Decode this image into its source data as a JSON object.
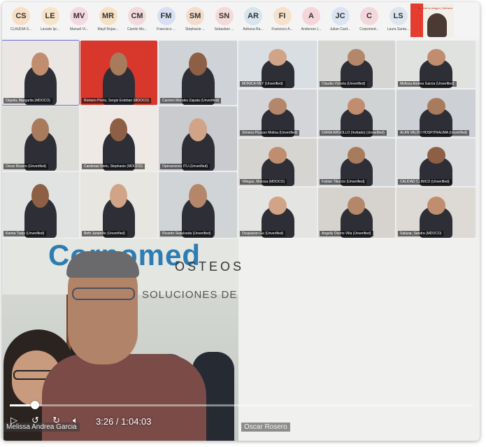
{
  "participants": [
    {
      "initials": "CS",
      "name": "CLAUDIA S...",
      "color": "#f6dfc4"
    },
    {
      "initials": "LE",
      "name": "Lavado Ije...",
      "color": "#f5e4c8"
    },
    {
      "initials": "MV",
      "name": "Manuel Vi...",
      "color": "#f4d8e3"
    },
    {
      "initials": "MR",
      "name": "Mayil Rojas...",
      "color": "#f5e2c4"
    },
    {
      "initials": "CM",
      "name": "Camilo Mu...",
      "color": "#f1d9dc"
    },
    {
      "initials": "FM",
      "name": "Francisco ...",
      "color": "#d8dff3"
    },
    {
      "initials": "SM",
      "name": "Stephanie ...",
      "color": "#f3dccb"
    },
    {
      "initials": "SN",
      "name": "Sebastian ...",
      "color": "#f5d9d9"
    },
    {
      "initials": "AR",
      "name": "Adriana Ra...",
      "color": "#d6e5ee"
    },
    {
      "initials": "FI",
      "name": "Francisco A...",
      "color": "#f5e1cc"
    },
    {
      "initials": "A",
      "name": "Anderson (...",
      "color": "#f4d6da"
    },
    {
      "initials": "JC",
      "name": "Julian Card...",
      "color": "#dbe4f3"
    },
    {
      "initials": "C",
      "name": "Corpomed...",
      "color": "#f4d7dc"
    },
    {
      "initials": "LS",
      "name": "Laura Santa...",
      "color": "#dde6ee"
    }
  ],
  "self_view": {
    "brand": "acelere la cirugía | Johnson"
  },
  "tiles": [
    {
      "label": "Orjuela, Margarita (MDOCO)"
    },
    {
      "label": "Romero Prieto, Sergio Esteban (MDOCO)"
    },
    {
      "label": "Carmen Morales Zapata (Unverified)"
    },
    {
      "label": "MONICA REY (Unverified)"
    },
    {
      "label": "Claudia Victoria (Unverified)"
    },
    {
      "label": "Melissa Andrea Garcia (Unverified)"
    },
    {
      "label": "Oscar Rosero (Unverified)"
    },
    {
      "label": "Cardenas Nieto, Stephanie (MDOCO)"
    },
    {
      "label": "Operaciones ITU (Unverified)"
    },
    {
      "label": "Ximena Picasso Molina (Unverified)"
    },
    {
      "label": "DIANA ARGOLLO (Invitado) (Unverified)"
    },
    {
      "label": "ALAN VALDO HOSPITRAUMA (Unverified)"
    },
    {
      "label": "Karina Tunjo (Unverified)"
    },
    {
      "label": "Beth Jaramillo (Unverified)"
    },
    {
      "label": "Ricardo Sepulveda (Unverified)"
    },
    {
      "label": "Villegas, Melissa (MDOCO)"
    },
    {
      "label": "Fabian Tiburcio (Unverified)"
    },
    {
      "label": "CALIDAD CLINICO (Unverified)"
    },
    {
      "label": "Ocupacion Ge (Unverified)"
    },
    {
      "label": "Angelly Osorio Villa (Unverified)"
    },
    {
      "label": "Salazar, Sandra (MDOCO)"
    }
  ],
  "stage": {
    "left_name": "Melissa Andrea Garcia",
    "right_name": "Oscar Rosero",
    "logo_main": "Corpomed",
    "logo_sub": "OSTEOS",
    "logo_tag": "SOLUCIONES DE"
  },
  "player": {
    "current_time": "3:26",
    "duration": "1:04:03",
    "time_text": "3:26 / 1:04:03",
    "progress": 0.054,
    "play_icon": "play-icon",
    "rewind_icon": "rewind-10-icon",
    "forward_icon": "forward-10-icon",
    "volume_icon": "volume-icon"
  }
}
